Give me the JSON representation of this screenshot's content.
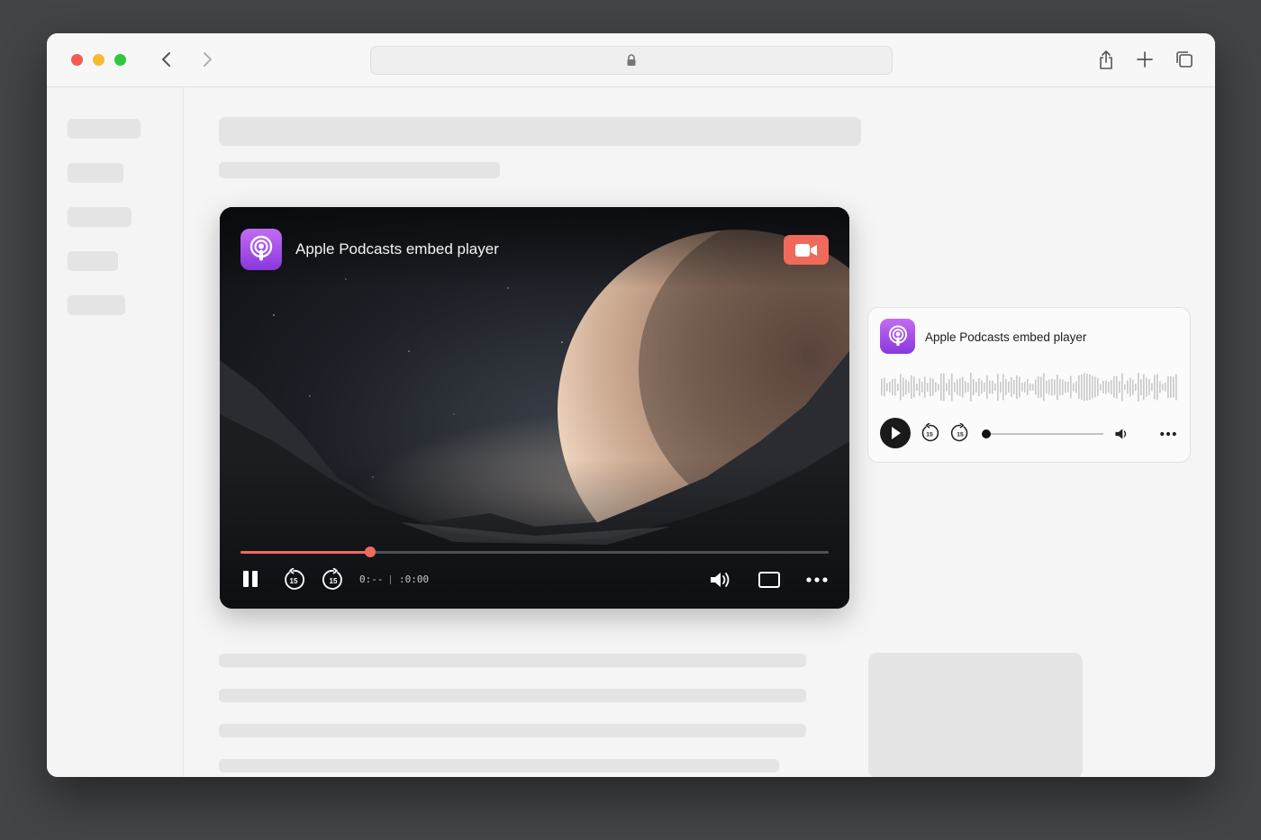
{
  "browser": {
    "address_text": "",
    "icons": {
      "back": "chevron-left-icon",
      "forward": "chevron-right-icon",
      "lock": "lock-icon",
      "share": "share-icon",
      "new_tab": "plus-icon",
      "tabs": "tabs-overview-icon"
    }
  },
  "video_player": {
    "title": "Apple Podcasts embed player",
    "current_time": "0:--",
    "duration": ":0:00",
    "progress": 0.22,
    "accent_color": "#ef6a5c",
    "icons": {
      "app": "podcasts-icon",
      "camera": "video-camera-icon",
      "pause": "pause-icon",
      "skip_back": "skip-back-15-icon",
      "skip_forward": "skip-forward-15-icon",
      "volume": "volume-icon",
      "screen": "screen-mode-icon",
      "more": "more-icon"
    }
  },
  "audio_player": {
    "title": "Apple Podcasts embed player",
    "progress": 0.0,
    "icons": {
      "app": "podcasts-icon",
      "play": "play-icon",
      "skip_back": "skip-back-15-icon",
      "skip_forward": "skip-forward-15-icon",
      "volume": "volume-icon",
      "more": "more-icon"
    }
  },
  "skip_label": "15",
  "brand_gradient": [
    "#c26cf3",
    "#8a37dd"
  ]
}
